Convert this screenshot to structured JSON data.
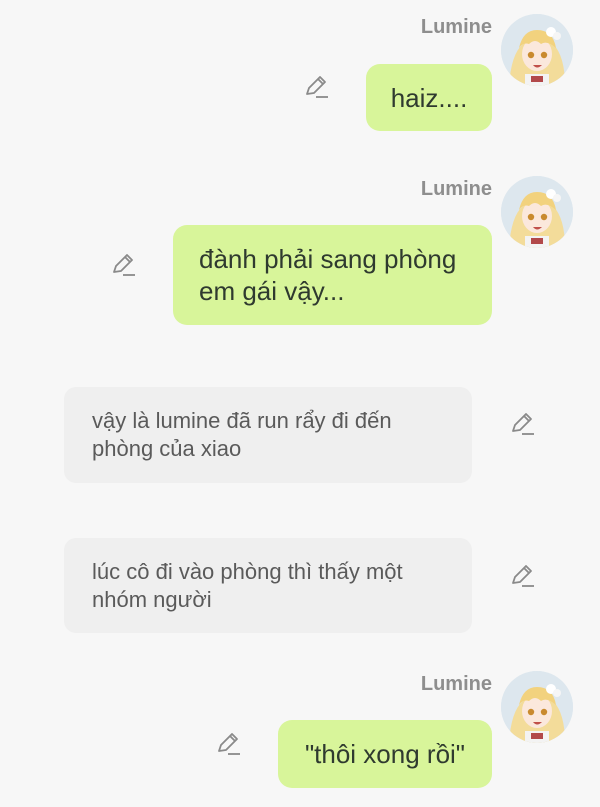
{
  "messages": [
    {
      "kind": "user",
      "author": "Lumine",
      "text": "haiz...."
    },
    {
      "kind": "user",
      "author": "Lumine",
      "text": "đành phải sang phòng em gái vậy..."
    },
    {
      "kind": "narration",
      "text": "vậy là lumine đã run rẩy đi đến phòng của xiao"
    },
    {
      "kind": "narration",
      "text": "lúc cô đi vào phòng thì thấy một nhóm người"
    },
    {
      "kind": "user",
      "author": "Lumine",
      "text": "\"thôi xong rồi\""
    }
  ],
  "icons": {
    "edit": "pencil-edit-icon",
    "avatar": "lumine-avatar"
  },
  "colors": {
    "background": "#f7f7f7",
    "user_bubble": "#d8f59a",
    "narration_bubble": "#efefef",
    "username": "#8e8e8e",
    "icon": "#8a8a8a"
  }
}
